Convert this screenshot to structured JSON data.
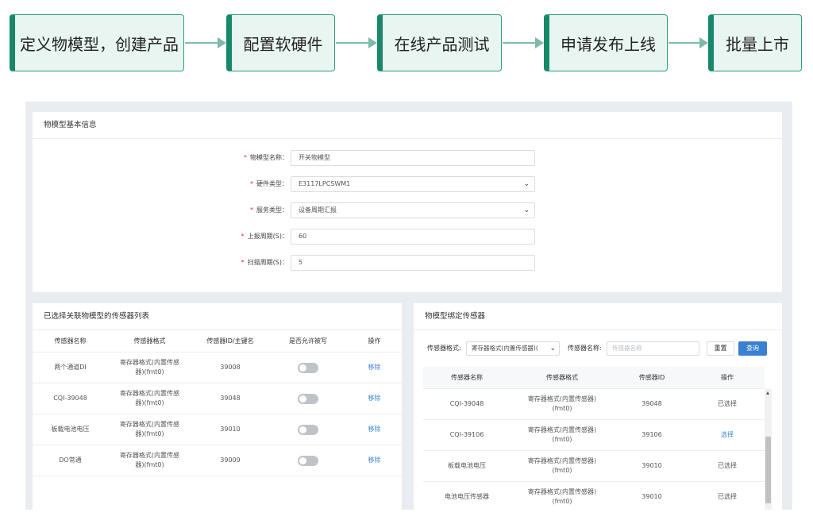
{
  "flow": {
    "steps": [
      "定义物模型，创建产品",
      "配置软硬件",
      "在线产品测试",
      "申请发布上线",
      "批量上市"
    ]
  },
  "basic_info": {
    "title": "物模型基本信息",
    "fields": [
      {
        "label": "物模型名称：",
        "value": "开关物模型",
        "type": "input",
        "required": true
      },
      {
        "label": "硬件类型：",
        "value": "E3117LPCSWM1",
        "type": "select",
        "required": true
      },
      {
        "label": "服务类型：",
        "value": "设备周期汇报",
        "type": "select",
        "required": true
      },
      {
        "label": "上报周期(S)：",
        "value": "60",
        "type": "input",
        "required": true
      },
      {
        "label": "扫描周期(S)：",
        "value": "5",
        "type": "input",
        "required": true
      }
    ]
  },
  "selected_sensors": {
    "title": "已选择关联物模型的传感器列表",
    "columns": [
      "传感器名称",
      "传感器格式",
      "传感器ID/主键名",
      "是否允许被写",
      "操作"
    ],
    "rows": [
      {
        "name": "两个通道DI",
        "format": "寄存器格式(内置传感器)(fmt0)",
        "id": "39008",
        "writable": false,
        "action": "移除"
      },
      {
        "name": "CQI-39048",
        "format": "寄存器格式(内置传感器)(fmt0)",
        "id": "39048",
        "writable": false,
        "action": "移除"
      },
      {
        "name": "板载电池电压",
        "format": "寄存器格式(内置传感器)(fmt0)",
        "id": "39010",
        "writable": false,
        "action": "移除"
      },
      {
        "name": "DO常通",
        "format": "寄存器格式(内置传感器)(fmt0)",
        "id": "39009",
        "writable": false,
        "action": "移除"
      }
    ]
  },
  "bind_sensors": {
    "title": "物模型绑定传感器",
    "filter": {
      "format_label": "传感器格式:",
      "format_value": "寄存器格式(内置传感器)(",
      "name_label": "传感器名称:",
      "name_placeholder": "传感器名称",
      "reset_label": "重置",
      "search_label": "查询"
    },
    "columns": [
      "传感器名称",
      "传感器格式",
      "传感器ID",
      "操作"
    ],
    "rows": [
      {
        "name": "CQI-39048",
        "format": "寄存器格式(内置传感器)(fmt0)",
        "id": "39048",
        "action": "已选择",
        "selectable": false
      },
      {
        "name": "CQI-39106",
        "format": "寄存器格式(内置传感器)(fmt0)",
        "id": "39106",
        "action": "选择",
        "selectable": true
      },
      {
        "name": "板载电池电压",
        "format": "寄存器格式(内置传感器)(fmt0)",
        "id": "39010",
        "action": "已选择",
        "selectable": false
      },
      {
        "name": "电池电压传感器",
        "format": "寄存器格式(内置传感器)(fmt0)",
        "id": "39010",
        "action": "已选择",
        "selectable": false
      }
    ]
  },
  "colors": {
    "step_fill": "#e8f5f1",
    "step_border": "#17896a",
    "link": "#3b82d6",
    "primary_button": "#3a7fd0",
    "required_mark": "#e0302a"
  }
}
